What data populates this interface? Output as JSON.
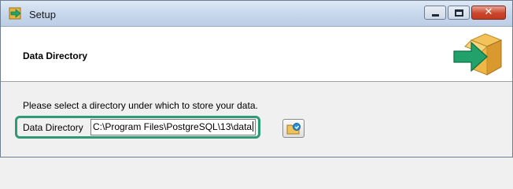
{
  "window": {
    "title": "Setup"
  },
  "header": {
    "title": "Data Directory"
  },
  "main": {
    "instruction": "Please select a directory under which to store your data.",
    "directory": {
      "label": "Data Directory",
      "value": "C:\\Program Files\\PostgreSQL\\13\\data"
    }
  },
  "colors": {
    "highlight": "#2e9a78",
    "header_bg": "#ffffff"
  },
  "icons": {
    "app": "setup-arrow-icon",
    "header": "box-arrow-icon",
    "browse": "folder-browse-icon"
  }
}
